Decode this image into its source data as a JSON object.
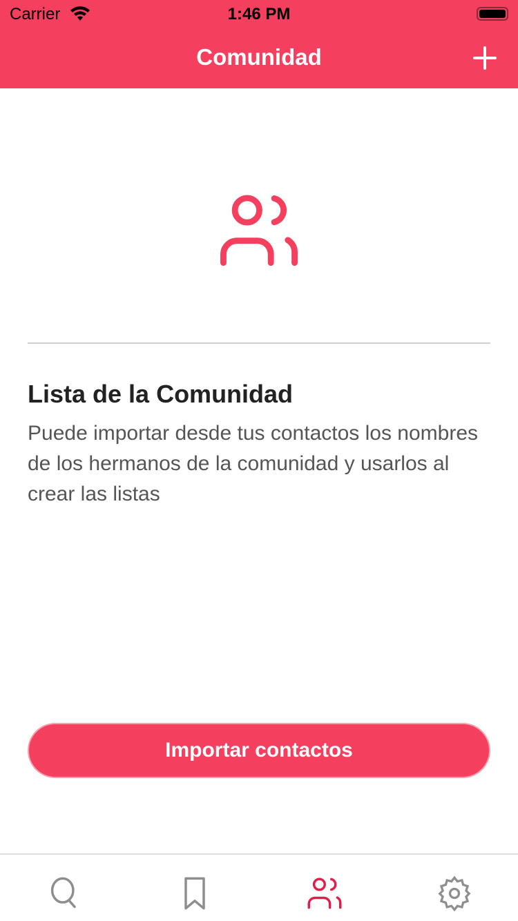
{
  "status_bar": {
    "carrier": "Carrier",
    "time": "1:46 PM"
  },
  "header": {
    "title": "Comunidad"
  },
  "empty_state": {
    "title": "Lista de la Comunidad",
    "description": "Puede importar desde tus contactos los nombres de los hermanos de la comunidad y usarlos al crear las listas"
  },
  "import_button": {
    "label": "Importar contactos"
  },
  "colors": {
    "accent": "#f43f5e",
    "tab_active": "#e11d48",
    "tab_inactive": "#8e8e8e"
  },
  "tabs": [
    {
      "icon": "search-icon"
    },
    {
      "icon": "bookmark-icon"
    },
    {
      "icon": "users-icon",
      "active": true
    },
    {
      "icon": "gear-icon"
    }
  ]
}
